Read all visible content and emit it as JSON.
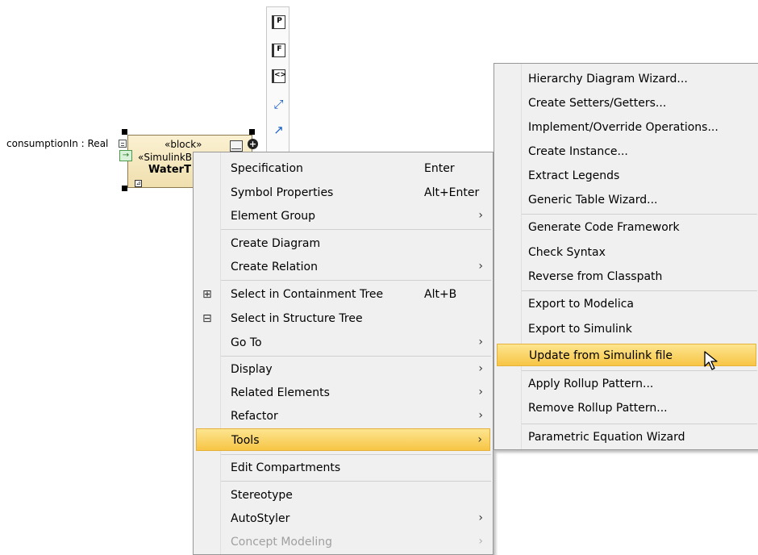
{
  "diagram": {
    "port_label": "consumptionIn : Real",
    "block_stereotype": "«block»",
    "block_stereotype2": "«SimulinkB",
    "block_name": "WaterT",
    "toolbar_icons": [
      "port-p-icon",
      "port-f-icon",
      "port-diamond-icon",
      "association-icon",
      "directed-association-icon"
    ],
    "toolbar_letters": [
      "P",
      "F",
      "<>"
    ]
  },
  "context_menu": {
    "items": [
      {
        "label": "Specification",
        "shortcut": "Enter"
      },
      {
        "label": "Symbol Properties",
        "shortcut": "Alt+Enter"
      },
      {
        "label": "Element Group",
        "arrow": "›"
      },
      {
        "label": "Create Diagram"
      },
      {
        "label": "Create Relation",
        "arrow": "›"
      },
      {
        "label": "Select in Containment Tree",
        "shortcut": "Alt+B",
        "icon": "containment-tree-icon"
      },
      {
        "label": "Select in Structure Tree",
        "icon": "structure-tree-icon"
      },
      {
        "label": "Go To",
        "arrow": "›"
      },
      {
        "label": "Display",
        "arrow": "›"
      },
      {
        "label": "Related Elements",
        "arrow": "›"
      },
      {
        "label": "Refactor",
        "arrow": "›"
      },
      {
        "label": "Tools",
        "arrow": "›",
        "highlighted": true
      },
      {
        "label": "Edit Compartments"
      },
      {
        "label": "Stereotype"
      },
      {
        "label": "AutoStyler",
        "arrow": "›"
      },
      {
        "label": "Concept Modeling",
        "arrow": "›",
        "disabled": true
      }
    ]
  },
  "tools_submenu": {
    "items": [
      {
        "label": "Hierarchy Diagram Wizard..."
      },
      {
        "label": "Create Setters/Getters..."
      },
      {
        "label": "Implement/Override Operations..."
      },
      {
        "label": "Create Instance..."
      },
      {
        "label": "Extract Legends"
      },
      {
        "label": "Generic Table Wizard..."
      },
      {
        "label": "Generate Code Framework"
      },
      {
        "label": "Check Syntax"
      },
      {
        "label": "Reverse from Classpath"
      },
      {
        "label": "Export to Modelica"
      },
      {
        "label": "Export to Simulink"
      },
      {
        "label": "Update from Simulink file",
        "highlighted": true
      },
      {
        "label": "Apply Rollup Pattern..."
      },
      {
        "label": "Remove Rollup Pattern..."
      },
      {
        "label": "Parametric Equation Wizard"
      }
    ]
  },
  "colors": {
    "menu_bg": "#f0f0f0",
    "highlight": "#f9d169",
    "block_fill": "#f5e7bd"
  }
}
